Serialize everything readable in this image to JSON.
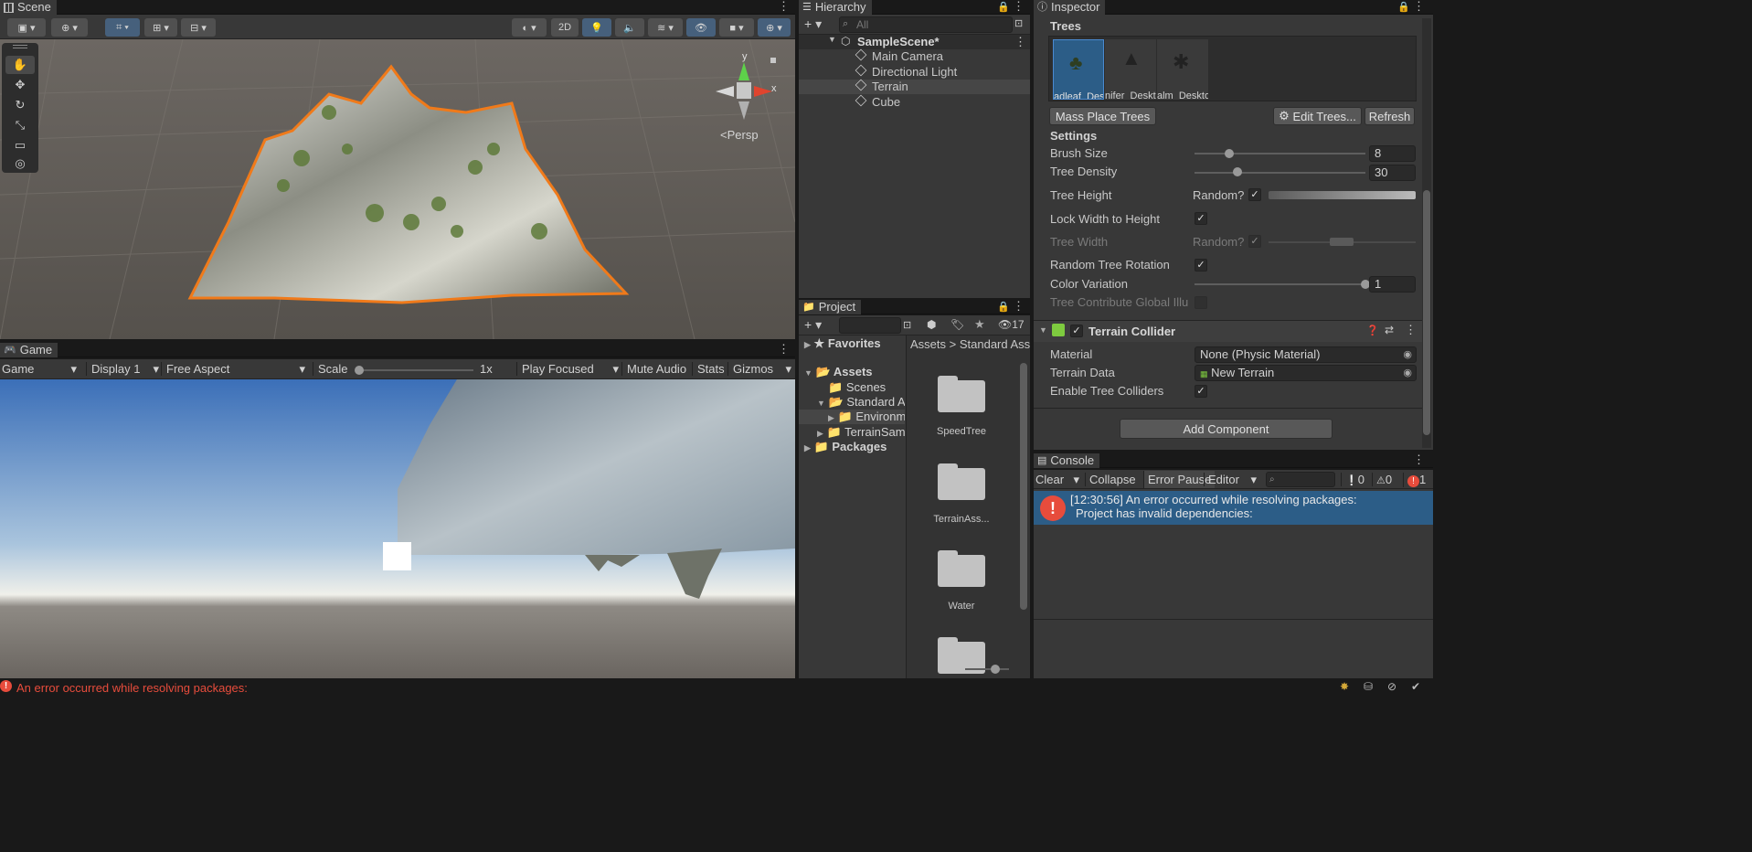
{
  "scene": {
    "tab": "Scene",
    "persp_label": "<Persp",
    "mode_2d": "2D",
    "axis_y": "y",
    "axis_x": "x"
  },
  "game": {
    "tab": "Game",
    "display_mode": "Game",
    "display": "Display 1",
    "aspect": "Free Aspect",
    "scale_label": "Scale",
    "scale_value": "1x",
    "play_mode": "Play Focused",
    "mute": "Mute Audio",
    "stats": "Stats",
    "gizmos": "Gizmos"
  },
  "hierarchy": {
    "tab": "Hierarchy",
    "search_placeholder": "All",
    "scene_name": "SampleScene*",
    "items": [
      "Main Camera",
      "Directional Light",
      "Terrain",
      "Cube"
    ],
    "selected": "Terrain"
  },
  "project": {
    "tab": "Project",
    "hidden_count": "17",
    "favorites": "Favorites",
    "tree": [
      "Assets",
      "Scenes",
      "Standard Assets",
      "Environment",
      "TerrainSamples",
      "Packages"
    ],
    "breadcrumb": [
      "Assets",
      "Standard Assets"
    ],
    "breadcrumb_sep": ">",
    "folders": [
      "SpeedTree",
      "TerrainAss...",
      "Water"
    ]
  },
  "inspector": {
    "tab": "Inspector",
    "trees_header": "Trees",
    "tree_prototypes": [
      "Broadleaf_Desktop",
      "Conifer_Desktop",
      "Palm_Desktop"
    ],
    "tree_labels": [
      "adleaf_Desk",
      "nifer_Deskt",
      "alm_Deskto"
    ],
    "mass_place": "Mass Place Trees",
    "edit_trees": "Edit Trees...",
    "refresh": "Refresh",
    "settings_header": "Settings",
    "brush_size_label": "Brush Size",
    "brush_size": "8",
    "brush_size_fraction": 0.18,
    "tree_density_label": "Tree Density",
    "tree_density": "30",
    "tree_density_fraction": 0.23,
    "tree_height_label": "Tree Height",
    "random_label": "Random?",
    "lock_width_label": "Lock Width to Height",
    "tree_width_label": "Tree Width",
    "random_rotation_label": "Random Tree Rotation",
    "color_variation_label": "Color Variation",
    "color_variation": "1",
    "color_variation_fraction": 1.0,
    "contribute_gi_label": "Tree Contribute Global Illu",
    "collider_title": "Terrain Collider",
    "material_label": "Material",
    "material_value": "None (Physic Material)",
    "terrain_data_label": "Terrain Data",
    "terrain_data_value": "New Terrain",
    "enable_colliders_label": "Enable Tree Colliders",
    "add_component": "Add Component"
  },
  "console": {
    "tab": "Console",
    "clear": "Clear",
    "collapse": "Collapse",
    "error_pause": "Error Pause",
    "editor": "Editor",
    "log_count": "0",
    "warn_count": "0",
    "error_count": "1",
    "message_line1": "[12:30:56] An error occurred while resolving packages:",
    "message_line2": "Project has invalid dependencies:"
  },
  "status_bar": {
    "message": "An error occurred while resolving packages:"
  },
  "colors": {
    "panel": "#383838",
    "selection": "#2c5d87",
    "error": "#e74c3c",
    "outline": "#f07a1a"
  }
}
